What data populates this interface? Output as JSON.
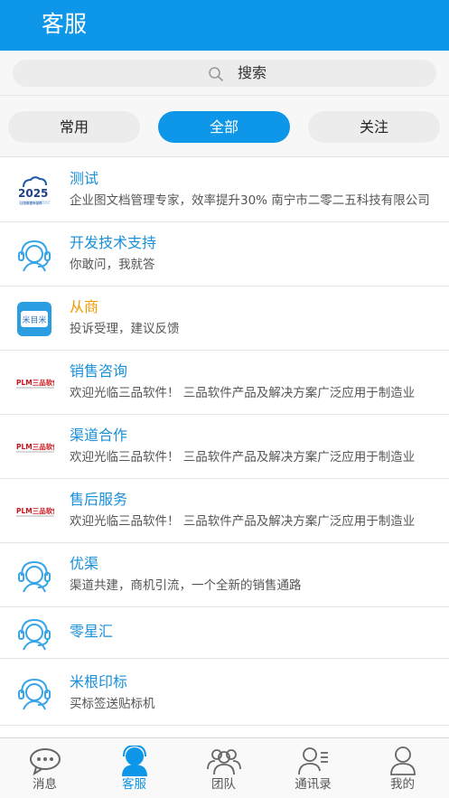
{
  "header": {
    "title": "客服"
  },
  "search": {
    "label": "搜索"
  },
  "tabs": [
    {
      "label": "常用",
      "active": false
    },
    {
      "label": "全部",
      "active": true
    },
    {
      "label": "关注",
      "active": false
    }
  ],
  "items": [
    {
      "name": "测试",
      "desc": "企业图文档管理专家，效率提升30% 南宁市二零二五科技有限公司",
      "icon": "logo-2025",
      "logo_text": "2025",
      "logo_sub": "让您数据有保障"
    },
    {
      "name": "开发技术支持",
      "desc": "你敢问，我就答",
      "icon": "headset-icon"
    },
    {
      "name": "从商",
      "desc": "投诉受理，建议反馈",
      "icon": "logo-mimi",
      "logo_text": "米目米",
      "name_color": "#f39800"
    },
    {
      "name": "销售咨询",
      "desc": "欢迎光临三品软件！    三品软件产品及解决方案广泛应用于制造业",
      "icon": "logo-plm",
      "logo_text": "PLM三品软件"
    },
    {
      "name": "渠道合作",
      "desc": "欢迎光临三品软件！    三品软件产品及解决方案广泛应用于制造业",
      "icon": "logo-plm",
      "logo_text": "PLM三品软件"
    },
    {
      "name": "售后服务",
      "desc": "欢迎光临三品软件！    三品软件产品及解决方案广泛应用于制造业",
      "icon": "logo-plm",
      "logo_text": "PLM三品软件"
    },
    {
      "name": "优渠",
      "desc": "渠道共建，商机引流，一个全新的销售通路",
      "icon": "headset-icon"
    },
    {
      "name": "零星汇",
      "desc": "",
      "icon": "headset-icon"
    },
    {
      "name": "米根印标",
      "desc": "买标签送贴标机",
      "icon": "headset-icon"
    }
  ],
  "tabbar": [
    {
      "label": "消息",
      "icon": "chat-bubble-icon",
      "active": false
    },
    {
      "label": "客服",
      "icon": "service-person-icon",
      "active": true
    },
    {
      "label": "团队",
      "icon": "team-icon",
      "active": false
    },
    {
      "label": "通讯录",
      "icon": "contacts-icon",
      "active": false
    },
    {
      "label": "我的",
      "icon": "profile-icon",
      "active": false
    }
  ],
  "colors": {
    "accent": "#0e96e8",
    "name_text": "#1a8fd8",
    "highlight": "#f39800"
  }
}
